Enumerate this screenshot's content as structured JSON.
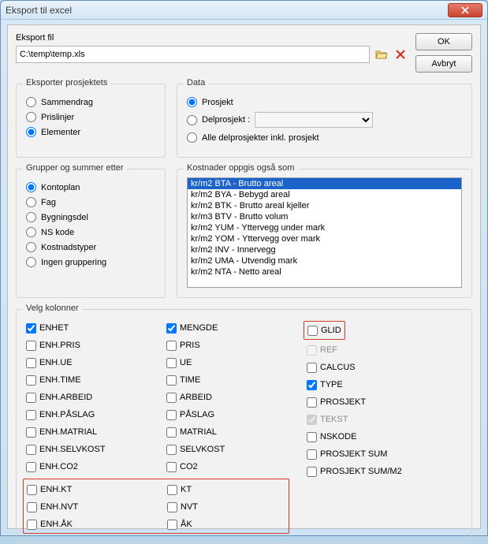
{
  "window": {
    "title": "Eksport til excel"
  },
  "buttons": {
    "ok": "OK",
    "cancel": "Avbryt"
  },
  "file": {
    "label": "Eksport fil",
    "value": "C:\\temp\\temp.xls"
  },
  "export_group": {
    "title": "Eksporter prosjektets",
    "options": {
      "sammendrag": "Sammendrag",
      "prislinjer": "Prislinjer",
      "elementer": "Elementer"
    },
    "selected": "elementer"
  },
  "data_group": {
    "title": "Data",
    "options": {
      "prosjekt": "Prosjekt",
      "delprosjekt": "Delprosjekt :",
      "alle": "Alle delprosjekter inkl. prosjekt"
    },
    "selected": "prosjekt"
  },
  "grupper_group": {
    "title": "Grupper og summer etter",
    "options": {
      "kontoplan": "Kontoplan",
      "fag": "Fag",
      "bygningsdel": "Bygningsdel",
      "nskode": "NS kode",
      "kostnadstyper": "Kostnadstyper",
      "ingen": "Ingen gruppering"
    },
    "selected": "kontoplan"
  },
  "kostnader_group": {
    "title": "Kostnader oppgis også som",
    "items": [
      "kr/m2 BTA - Brutto areal",
      "kr/m2 BYA - Bebygd areal",
      "kr/m2 BTK - Brutto areal kjeller",
      "kr/m3 BTV - Brutto volum",
      "kr/m2 YUM - Yttervegg under mark",
      "kr/m2 YOM - Yttervegg over mark",
      "kr/m2 INV - Innervegg",
      "kr/m2 UMA - Utvendig mark",
      "kr/m2 NTA - Netto areal"
    ],
    "selected_index": 0
  },
  "kolonner_group": {
    "title": "Velg kolonner",
    "col1": [
      {
        "label": "ENHET",
        "checked": true
      },
      {
        "label": "ENH.PRIS",
        "checked": false
      },
      {
        "label": "ENH.UE",
        "checked": false
      },
      {
        "label": "ENH.TIME",
        "checked": false
      },
      {
        "label": "ENH.ARBEID",
        "checked": false
      },
      {
        "label": "ENH.PÅSLAG",
        "checked": false
      },
      {
        "label": "ENH.MATRIAL",
        "checked": false
      },
      {
        "label": "ENH.SELVKOST",
        "checked": false
      },
      {
        "label": "ENH.CO2",
        "checked": false
      }
    ],
    "col2": [
      {
        "label": "MENGDE",
        "checked": true
      },
      {
        "label": "PRIS",
        "checked": false
      },
      {
        "label": "UE",
        "checked": false
      },
      {
        "label": "TIME",
        "checked": false
      },
      {
        "label": "ARBEID",
        "checked": false
      },
      {
        "label": "PÅSLAG",
        "checked": false
      },
      {
        "label": "MATRIAL",
        "checked": false
      },
      {
        "label": "SELVKOST",
        "checked": false
      },
      {
        "label": "CO2",
        "checked": false
      }
    ],
    "col3": [
      {
        "label": "GLID",
        "checked": false,
        "highlight": true
      },
      {
        "label": "REF",
        "checked": false,
        "disabled": true
      },
      {
        "label": "CALCUS",
        "checked": false
      },
      {
        "label": "TYPE",
        "checked": true
      },
      {
        "label": "PROSJEKT",
        "checked": false
      },
      {
        "label": "TEKST",
        "checked": true,
        "disabled": true
      },
      {
        "label": "NSKODE",
        "checked": false
      },
      {
        "label": "PROSJEKT SUM",
        "checked": false
      },
      {
        "label": "PROSJEKT SUM/M2",
        "checked": false
      }
    ],
    "red_extra_col1": [
      {
        "label": "ENH.KT",
        "checked": false
      },
      {
        "label": "ENH.NVT",
        "checked": false
      },
      {
        "label": "ENH.ÅK",
        "checked": false
      }
    ],
    "red_extra_col2": [
      {
        "label": "KT",
        "checked": false
      },
      {
        "label": "NVT",
        "checked": false
      },
      {
        "label": "ÅK",
        "checked": false
      }
    ]
  }
}
